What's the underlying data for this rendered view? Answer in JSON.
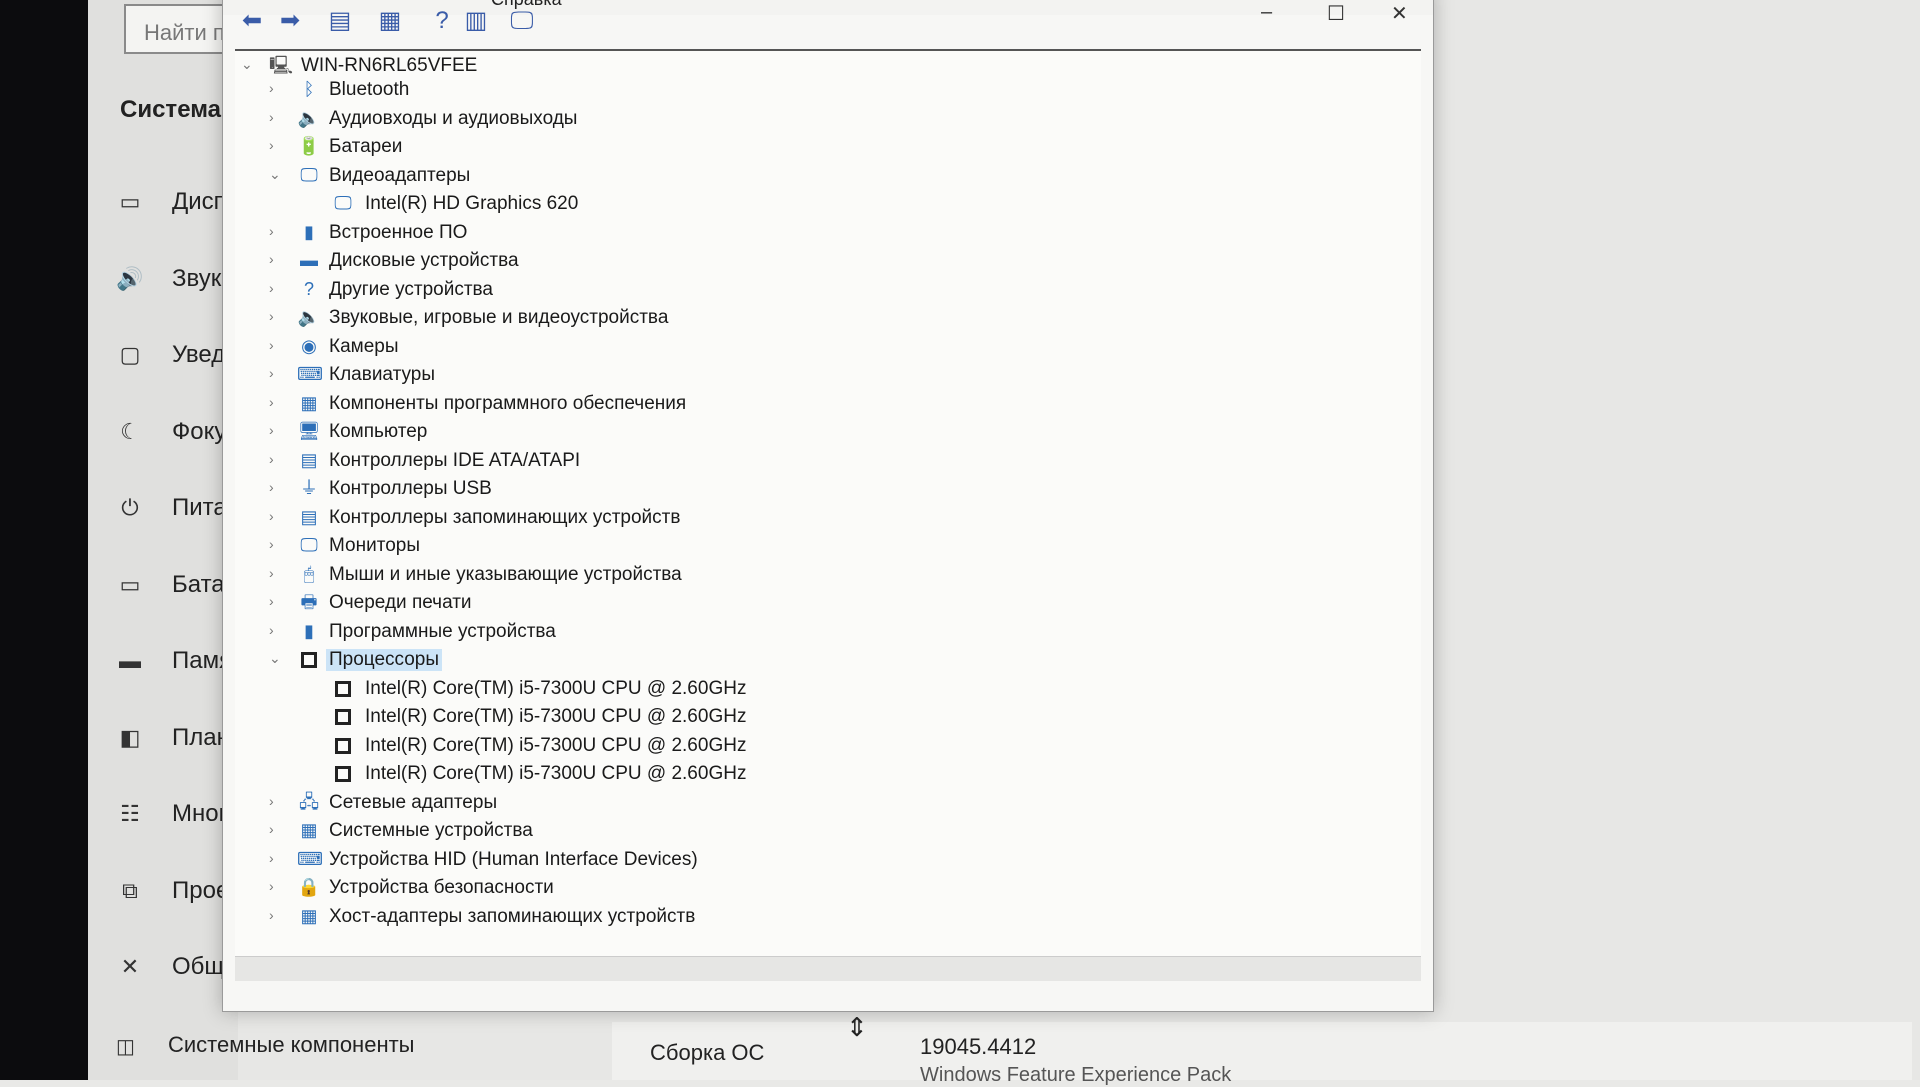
{
  "settings": {
    "search_placeholder": "Найти п",
    "section_title": "Система",
    "nav": [
      {
        "label": "Дисп",
        "icon": "display-icon"
      },
      {
        "label": "Звук",
        "icon": "sound-icon"
      },
      {
        "label": "Увед",
        "icon": "notifications-icon"
      },
      {
        "label": "Фоку",
        "icon": "focus-moon-icon"
      },
      {
        "label": "Пита",
        "icon": "power-icon"
      },
      {
        "label": "Батар",
        "icon": "battery-icon"
      },
      {
        "label": "Памя",
        "icon": "storage-icon"
      },
      {
        "label": "План",
        "icon": "tablet-icon"
      },
      {
        "label": "Мног",
        "icon": "multitasking-icon"
      },
      {
        "label": "Прое",
        "icon": "projecting-icon"
      },
      {
        "label": "Общ",
        "icon": "shared-experiences-icon"
      }
    ],
    "system_components": "Системные компоненты",
    "os_build_label": "Сборка ОС",
    "os_build_value": "19045.4412",
    "os_pack_partial": "Windows Feature Experience Pack"
  },
  "device_manager": {
    "menu_help": "Справка",
    "window_buttons": {
      "minimize": "–",
      "maximize": "☐",
      "close": "✕"
    },
    "toolbar_icons": [
      "back-icon",
      "forward-icon",
      "properties-icon",
      "update-icon",
      "help-icon",
      "view-icon",
      "monitor-icon"
    ],
    "root": "WIN-RN6RL65VFEE",
    "tree": [
      {
        "label": "Bluetooth",
        "expanded": false
      },
      {
        "label": "Аудиовходы и аудиовыходы",
        "expanded": false
      },
      {
        "label": "Батареи",
        "expanded": false
      },
      {
        "label": "Видеоадаптеры",
        "expanded": true,
        "children": [
          "Intel(R) HD Graphics 620"
        ]
      },
      {
        "label": "Встроенное ПО",
        "expanded": false
      },
      {
        "label": "Дисковые устройства",
        "expanded": false
      },
      {
        "label": "Другие устройства",
        "expanded": false
      },
      {
        "label": "Звуковые, игровые и видеоустройства",
        "expanded": false
      },
      {
        "label": "Камеры",
        "expanded": false
      },
      {
        "label": "Клавиатуры",
        "expanded": false
      },
      {
        "label": "Компоненты программного обеспечения",
        "expanded": false
      },
      {
        "label": "Компьютер",
        "expanded": false
      },
      {
        "label": "Контроллеры IDE ATA/ATAPI",
        "expanded": false
      },
      {
        "label": "Контроллеры USB",
        "expanded": false
      },
      {
        "label": "Контроллеры запоминающих устройств",
        "expanded": false
      },
      {
        "label": "Мониторы",
        "expanded": false
      },
      {
        "label": "Мыши и иные указывающие устройства",
        "expanded": false
      },
      {
        "label": "Очереди печати",
        "expanded": false
      },
      {
        "label": "Программные устройства",
        "expanded": false
      },
      {
        "label": "Процессоры",
        "expanded": true,
        "selected": true,
        "children": [
          "Intel(R) Core(TM) i5-7300U CPU @ 2.60GHz",
          "Intel(R) Core(TM) i5-7300U CPU @ 2.60GHz",
          "Intel(R) Core(TM) i5-7300U CPU @ 2.60GHz",
          "Intel(R) Core(TM) i5-7300U CPU @ 2.60GHz"
        ]
      },
      {
        "label": "Сетевые адаптеры",
        "expanded": false
      },
      {
        "label": "Системные устройства",
        "expanded": false
      },
      {
        "label": "Устройства HID (Human Interface Devices)",
        "expanded": false
      },
      {
        "label": "Устройства безопасности",
        "expanded": false
      },
      {
        "label": "Хост-адаптеры запоминающих устройств",
        "expanded": false
      }
    ]
  }
}
